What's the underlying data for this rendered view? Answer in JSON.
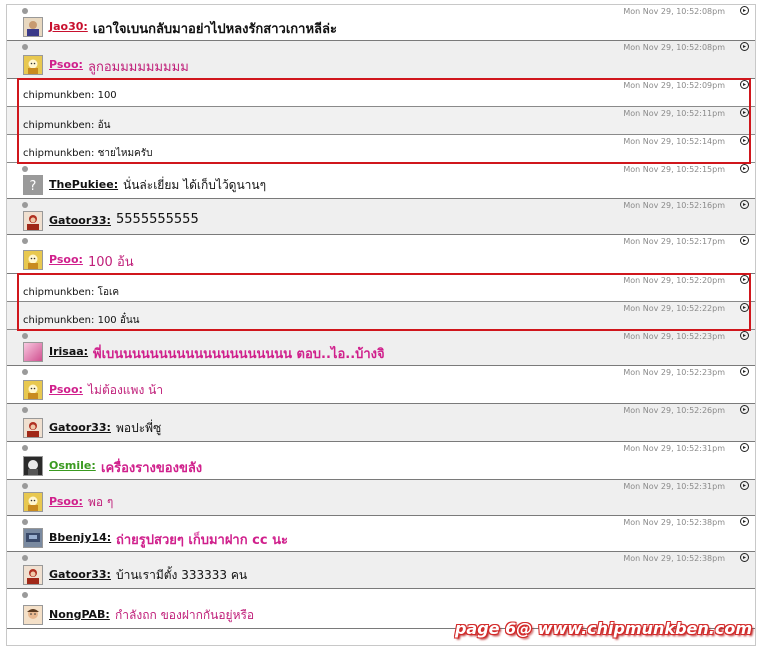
{
  "chat": {
    "messages": [
      {
        "kind": "user",
        "user": "Jao30:",
        "user_color": "#c8102e",
        "text": "เอาใจเบนกลับมาอย่าไปหลงรักสาวเกาหลีล่ะ",
        "text_color": "#111111",
        "text_size": 13,
        "text_bold": true,
        "time": "Mon Nov 29, 10:52:08pm",
        "avatar": "jao",
        "height": 36
      },
      {
        "kind": "user",
        "user": "Psoo:",
        "user_color": "#d0208c",
        "text": "ลูกอมมมมมมมมม",
        "text_color": "#c0207a",
        "text_size": 13,
        "text_bold": false,
        "time": "Mon Nov 29, 10:52:08pm",
        "avatar": "psoo",
        "height": 38
      },
      {
        "kind": "bot",
        "user": "chipmunkben:",
        "text": "100",
        "time": "Mon Nov 29, 10:52:09pm",
        "height": 28
      },
      {
        "kind": "bot",
        "user": "chipmunkben:",
        "text": "อ้น",
        "time": "Mon Nov 29, 10:52:11pm",
        "height": 28
      },
      {
        "kind": "bot",
        "user": "chipmunkben:",
        "text": "ชายไหมครับ",
        "time": "Mon Nov 29, 10:52:14pm",
        "height": 28
      },
      {
        "kind": "user",
        "user": "ThePukiee:",
        "user_color": "#111111",
        "text": "นั่นล่ะเยี่ยม ได้เก็บไว้ดูนานๆ",
        "text_color": "#111111",
        "text_size": 12,
        "text_bold": false,
        "time": "Mon Nov 29, 10:52:15pm",
        "avatar": "pukiee",
        "height": 36
      },
      {
        "kind": "user",
        "user": "Gatoor33:",
        "user_color": "#111111",
        "text": "5555555555",
        "text_color": "#111111",
        "text_size": 13,
        "text_bold": false,
        "time": "Mon Nov 29, 10:52:16pm",
        "avatar": "gatoor",
        "height": 36
      },
      {
        "kind": "user",
        "user": "Psoo:",
        "user_color": "#d0208c",
        "text": "100 อ้น",
        "text_color": "#c0207a",
        "text_size": 13,
        "text_bold": false,
        "time": "Mon Nov 29, 10:52:17pm",
        "avatar": "psoo",
        "height": 39
      },
      {
        "kind": "bot",
        "user": "chipmunkben:",
        "text": "โอเค",
        "time": "Mon Nov 29, 10:52:20pm",
        "height": 28
      },
      {
        "kind": "bot",
        "user": "chipmunkben:",
        "text": "100 อั๋นน",
        "time": "Mon Nov 29, 10:52:22pm",
        "height": 28
      },
      {
        "kind": "user",
        "user": "Irisaa:",
        "user_color": "#111111",
        "text": "พี่เบนนนนนนนนนนนนนนนนนนนน ตอบ..ไอ..บ้างจิ",
        "text_color": "#d0208c",
        "text_size": 13,
        "text_bold": true,
        "time": "Mon Nov 29, 10:52:23pm",
        "avatar": "irisaa",
        "height": 36
      },
      {
        "kind": "user",
        "user": "Psoo:",
        "user_color": "#d0208c",
        "text": "ไม่ต้องแพง น้า",
        "text_color": "#c0207a",
        "text_size": 12,
        "text_bold": false,
        "time": "Mon Nov 29, 10:52:23pm",
        "avatar": "psoo",
        "height": 38
      },
      {
        "kind": "user",
        "user": "Gatoor33:",
        "user_color": "#111111",
        "text": "พอปะพี่ซู",
        "text_color": "#111111",
        "text_size": 12,
        "text_bold": false,
        "time": "Mon Nov 29, 10:52:26pm",
        "avatar": "gatoor",
        "height": 38
      },
      {
        "kind": "user",
        "user": "Osmile:",
        "user_color": "#3a9a20",
        "text": "เครื่องรางของขลัง",
        "text_color": "#d0208c",
        "text_size": 13,
        "text_bold": true,
        "time": "Mon Nov 29, 10:52:31pm",
        "avatar": "osmile",
        "height": 38
      },
      {
        "kind": "user",
        "user": "Psoo:",
        "user_color": "#d0208c",
        "text": "พอ ๆ",
        "text_color": "#c0207a",
        "text_size": 12,
        "text_bold": false,
        "time": "Mon Nov 29, 10:52:31pm",
        "avatar": "psoo",
        "height": 36
      },
      {
        "kind": "user",
        "user": "Bbenjy14:",
        "user_color": "#111111",
        "text": "ถ่ายรูปสวยๆ เก็บมาฝาก cc นะ",
        "text_color": "#d0208c",
        "text_size": 13,
        "text_bold": true,
        "time": "Mon Nov 29, 10:52:38pm",
        "avatar": "bbenjy",
        "height": 36
      },
      {
        "kind": "user",
        "user": "Gatoor33:",
        "user_color": "#111111",
        "text": "บ้านเรามีตั้ง 333333  คน",
        "text_color": "#111111",
        "text_size": 12,
        "text_bold": false,
        "time": "Mon Nov 29, 10:52:38pm",
        "avatar": "gatoor",
        "height": 37
      },
      {
        "kind": "user",
        "user": "NongPAB:",
        "user_color": "#111111",
        "text": "กำลังถก ของฝากกันอยู่หรือ",
        "text_color": "#c0207a",
        "text_size": 12,
        "text_bold": false,
        "time": "",
        "avatar": "nongpab",
        "height": 40
      }
    ]
  },
  "highlights": [
    {
      "from": 2,
      "to": 4
    },
    {
      "from": 8,
      "to": 9
    }
  ],
  "watermark": "page 6@ www.chipmunkben.com",
  "colors": {
    "highlight": "#d0161c",
    "timestamp": "#8a8a8a",
    "divider": "#7a7a7a"
  }
}
